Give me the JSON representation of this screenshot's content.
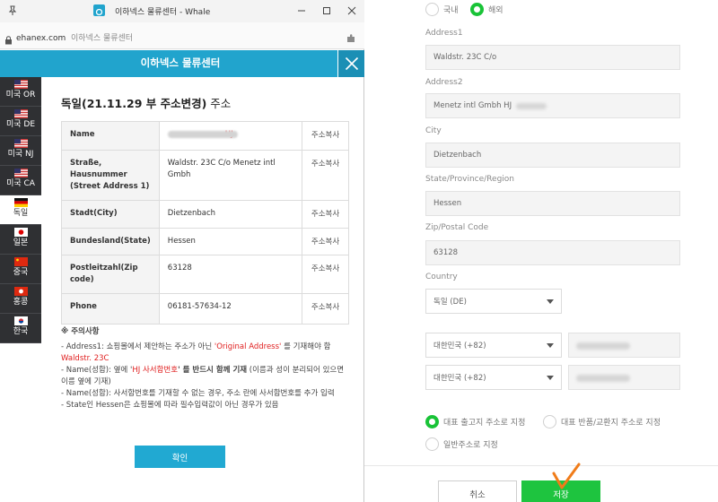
{
  "window": {
    "title": "이하넥스 물류센터 - Whale",
    "url_host": "ehanex.com",
    "url_title": "이하넥스 물류센터"
  },
  "header": {
    "title": "이하넥스 물류센터"
  },
  "nav": {
    "items": [
      {
        "label": "미국 OR",
        "flag": "us"
      },
      {
        "label": "미국 DE",
        "flag": "us"
      },
      {
        "label": "미국 NJ",
        "flag": "us"
      },
      {
        "label": "미국 CA",
        "flag": "us"
      },
      {
        "label": "독일",
        "flag": "de",
        "active": true
      },
      {
        "label": "일본",
        "flag": "jp"
      },
      {
        "label": "중국",
        "flag": "cn"
      },
      {
        "label": "홍콩",
        "flag": "hk"
      },
      {
        "label": "한국",
        "flag": "kr"
      }
    ]
  },
  "page": {
    "title_bold": "독일(21.11.29 부 주소변경)",
    "title_rest": " 주소"
  },
  "address_table": {
    "copy_label": "주소복사",
    "rows": [
      {
        "key": "Name",
        "value": "HJ",
        "value_red": true
      },
      {
        "key": "Straße, Hausnummer (Street Address 1)",
        "value": "Waldstr. 23C C/o Menetz intl Gmbh"
      },
      {
        "key": "Stadt(City)",
        "value": "Dietzenbach"
      },
      {
        "key": "Bundesland(State)",
        "value": "Hessen"
      },
      {
        "key": "Postleitzahl(Zip code)",
        "value": "63128"
      },
      {
        "key": "Phone",
        "value": "06181-57634-12"
      }
    ]
  },
  "notes": {
    "title": "※ 주의사항",
    "line1_pre": "- Address1: 쇼핑몰에서 제안하는 주소가 아닌 ",
    "line1_red": "'Original Address'",
    "line1_post": " 를 기재해야 함 ",
    "line1_red2": "Waldstr. 23C",
    "line2_pre": "- Name(성함): 옆에 '",
    "line2_red": "HJ 사서함번호",
    "line2_mid": "' 를 반드시 함께 기재",
    "line2_post": " (이름과 성이 분리되어 있으면 이름 옆에 기재)",
    "line3": "- Name(성함): 사서함번호를 기재할 수 없는 경우, 주소 란에 사서함번호를 추가 입력",
    "line4": "- State인 Hessen은 쇼핑몰에 따라 필수입력값이 아닌 경우가 있음"
  },
  "confirm_label": "확인",
  "form": {
    "radio_domestic": "국내",
    "radio_overseas": "해외",
    "address1_label": "Address1",
    "address1_value": "Waldstr. 23C C/o",
    "address2_label": "Address2",
    "address2_value": "Menetz intl Gmbh HJ",
    "city_label": "City",
    "city_value": "Dietzenbach",
    "state_label": "State/Province/Region",
    "state_value": "Hessen",
    "zip_label": "Zip/Postal Code",
    "zip_value": "63128",
    "country_label": "Country",
    "country_value": "독일 (DE)",
    "phone1_code": "대한민국 (+82)",
    "phone2_code": "대한민국 (+82)",
    "opt_default_shipping": "대표 출고지 주소로 지정",
    "opt_default_return": "대표 반품/교환지 주소로 지정",
    "opt_general": "일반주소로 지정",
    "cancel_label": "취소",
    "save_label": "저장"
  },
  "colors": {
    "accent_blue": "#21a4cd",
    "accent_green": "#1ec43f",
    "annotation_orange": "#f07c1a"
  }
}
